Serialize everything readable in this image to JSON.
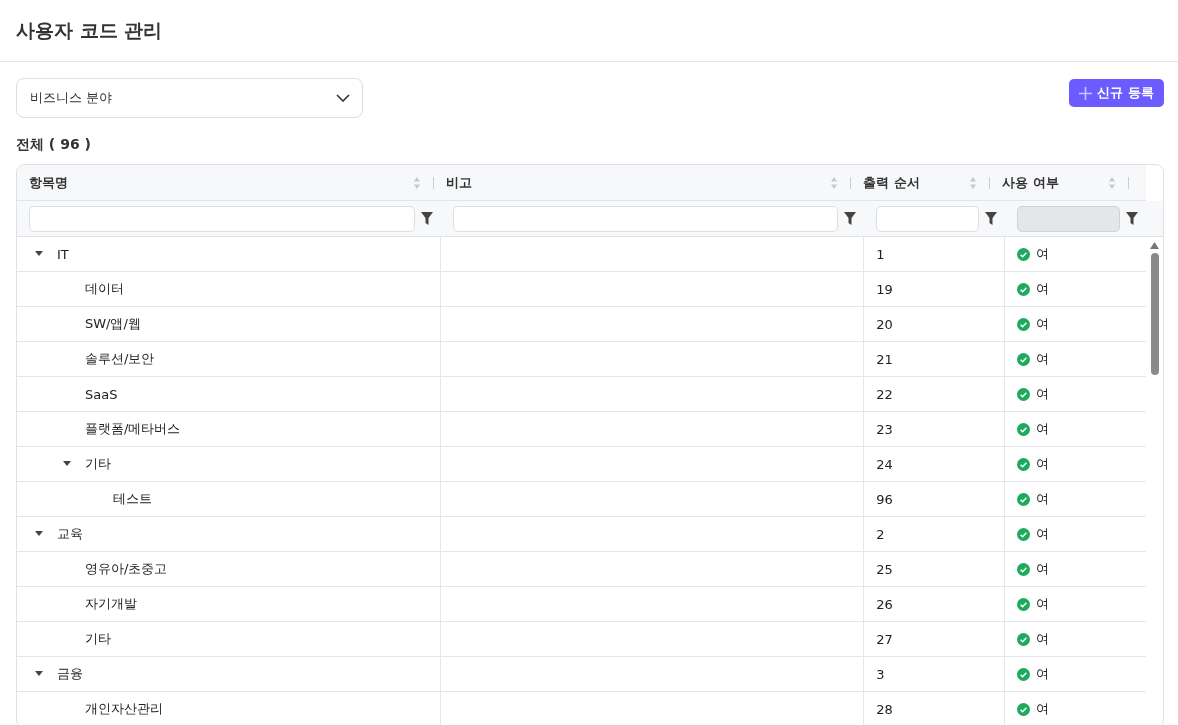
{
  "page_title": "사용자 코드 관리",
  "category_select": {
    "value": "비즈니스 분야"
  },
  "new_button": {
    "label": "신규 등록"
  },
  "total": "전체 ( 96 )",
  "table": {
    "columns": [
      {
        "label": "항목명",
        "filter_disabled": false
      },
      {
        "label": "비고",
        "filter_disabled": false
      },
      {
        "label": "출력 순서",
        "filter_disabled": false
      },
      {
        "label": "사용 여부",
        "filter_disabled": true
      }
    ],
    "rows": [
      {
        "name": "IT",
        "note": "",
        "order": "1",
        "use": "여",
        "used": true,
        "expanded": true,
        "children": [
          {
            "name": "데이터",
            "order": "19",
            "use": "여",
            "used": true
          },
          {
            "name": "SW/앱/웹",
            "order": "20",
            "use": "여",
            "used": true
          },
          {
            "name": "솔루션/보안",
            "order": "21",
            "use": "여",
            "used": true
          },
          {
            "name": "SaaS",
            "order": "22",
            "use": "여",
            "used": true
          },
          {
            "name": "플랫폼/메타버스",
            "order": "23",
            "use": "여",
            "used": true
          },
          {
            "name": "기타",
            "order": "24",
            "use": "여",
            "used": true,
            "expanded": true,
            "children": [
              {
                "name": "테스트",
                "order": "96",
                "use": "여",
                "used": true
              }
            ]
          }
        ]
      },
      {
        "name": "교육",
        "order": "2",
        "use": "여",
        "used": true,
        "expanded": true,
        "children": [
          {
            "name": "영유아/초중고",
            "order": "25",
            "use": "여",
            "used": true
          },
          {
            "name": "자기개발",
            "order": "26",
            "use": "여",
            "used": true
          },
          {
            "name": "기타",
            "order": "27",
            "use": "여",
            "used": true
          }
        ]
      },
      {
        "name": "금융",
        "order": "3",
        "use": "여",
        "used": true,
        "expanded": true,
        "children": [
          {
            "name": "개인자산관리",
            "order": "28",
            "use": "여",
            "used": true
          }
        ]
      }
    ]
  }
}
